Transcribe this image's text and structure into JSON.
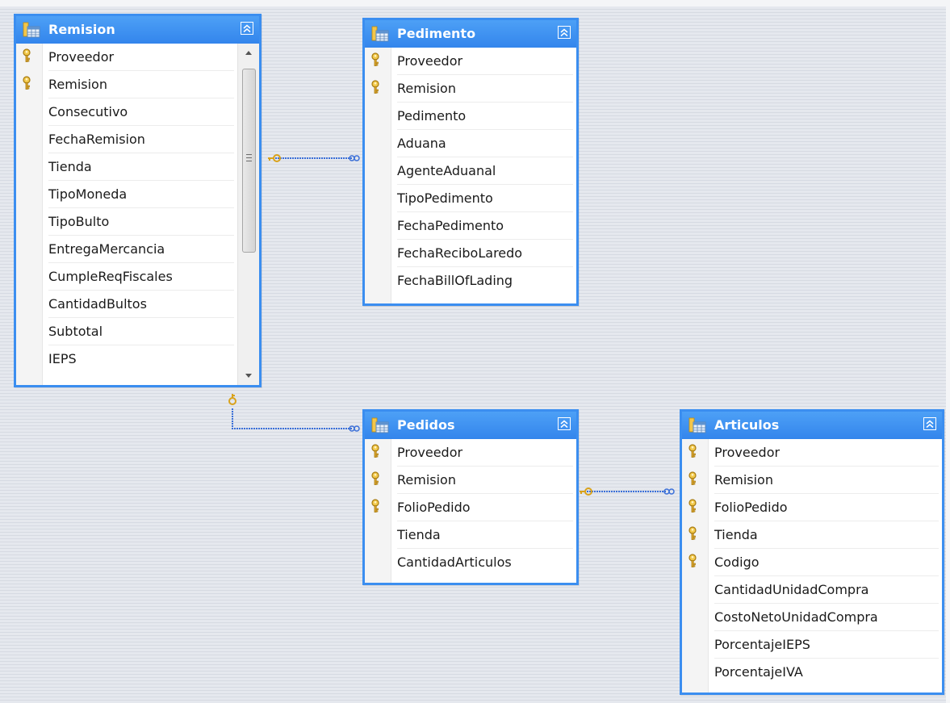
{
  "tables": {
    "remision": {
      "title": "Remision",
      "columns": [
        {
          "name": "Proveedor",
          "key": true
        },
        {
          "name": "Remision",
          "key": true
        },
        {
          "name": "Consecutivo",
          "key": false
        },
        {
          "name": "FechaRemision",
          "key": false
        },
        {
          "name": "Tienda",
          "key": false
        },
        {
          "name": "TipoMoneda",
          "key": false
        },
        {
          "name": "TipoBulto",
          "key": false
        },
        {
          "name": "EntregaMercancia",
          "key": false
        },
        {
          "name": "CumpleReqFiscales",
          "key": false
        },
        {
          "name": "CantidadBultos",
          "key": false
        },
        {
          "name": "Subtotal",
          "key": false
        },
        {
          "name": "IEPS",
          "key": false
        }
      ]
    },
    "pedimento": {
      "title": "Pedimento",
      "columns": [
        {
          "name": "Proveedor",
          "key": true
        },
        {
          "name": "Remision",
          "key": true
        },
        {
          "name": "Pedimento",
          "key": false
        },
        {
          "name": "Aduana",
          "key": false
        },
        {
          "name": "AgenteAduanal",
          "key": false
        },
        {
          "name": "TipoPedimento",
          "key": false
        },
        {
          "name": "FechaPedimento",
          "key": false
        },
        {
          "name": "FechaReciboLaredo",
          "key": false
        },
        {
          "name": "FechaBillOfLading",
          "key": false
        }
      ]
    },
    "pedidos": {
      "title": "Pedidos",
      "columns": [
        {
          "name": "Proveedor",
          "key": true
        },
        {
          "name": "Remision",
          "key": true
        },
        {
          "name": "FolioPedido",
          "key": true
        },
        {
          "name": "Tienda",
          "key": false
        },
        {
          "name": "CantidadArticulos",
          "key": false
        }
      ]
    },
    "articulos": {
      "title": "Articulos",
      "columns": [
        {
          "name": "Proveedor",
          "key": true
        },
        {
          "name": "Remision",
          "key": true
        },
        {
          "name": "FolioPedido",
          "key": true
        },
        {
          "name": "Tienda",
          "key": true
        },
        {
          "name": "Codigo",
          "key": true
        },
        {
          "name": "CantidadUnidadCompra",
          "key": false
        },
        {
          "name": "CostoNetoUnidadCompra",
          "key": false
        },
        {
          "name": "PorcentajeIEPS",
          "key": false
        },
        {
          "name": "PorcentajeIVA",
          "key": false
        }
      ]
    }
  },
  "relationships": [
    {
      "from": "remision",
      "to": "pedimento",
      "from_end": "key",
      "to_end": "infinity"
    },
    {
      "from": "remision",
      "to": "pedidos",
      "from_end": "key",
      "to_end": "infinity"
    },
    {
      "from": "pedidos",
      "to": "articulos",
      "from_end": "key",
      "to_end": "infinity"
    }
  ],
  "colors": {
    "table_border": "#3b8ef0",
    "header_fill": "#3b8ef0",
    "relationship_line": "#3a6fd8",
    "key_icon": "#d9a21b"
  },
  "icons": {
    "table": "table-icon",
    "key": "primary-key-icon",
    "collapse": "collapse-icon",
    "scroll_up": "scroll-up-arrow-icon",
    "scroll_down": "scroll-down-arrow-icon"
  }
}
